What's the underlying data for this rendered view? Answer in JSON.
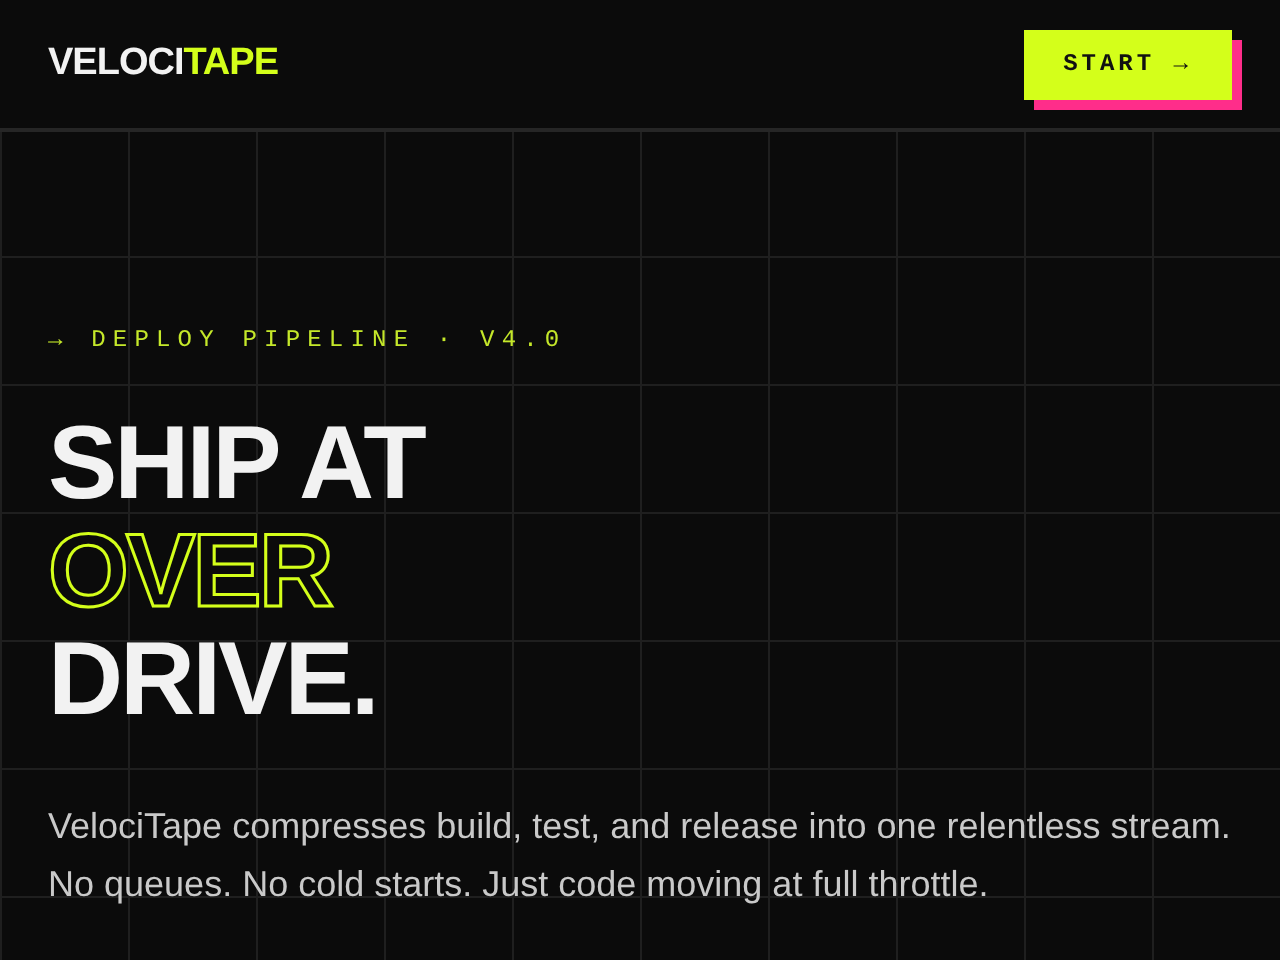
{
  "header": {
    "logo": {
      "primary": "VELOCI",
      "accent": "TAPE"
    },
    "cta": {
      "label": "START →"
    }
  },
  "hero": {
    "eyebrow": "→ DEPLOY PIPELINE · V4.0",
    "headline": [
      {
        "text": "SHIP AT",
        "kind": "solid"
      },
      {
        "text": "OVER",
        "kind": "outline"
      },
      {
        "text": "DRIVE.",
        "kind": "solid"
      }
    ],
    "description": "VelociTape compresses build, test, and release into one relentless stream. No queues. No cold starts. Just code moving at full throttle."
  }
}
